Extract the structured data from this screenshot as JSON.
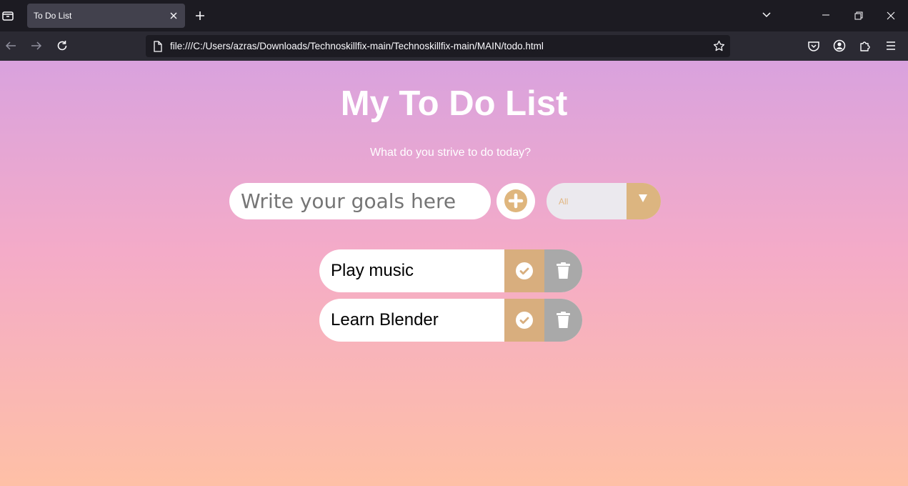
{
  "browser": {
    "tab_title": "To Do List",
    "url": "file:///C:/Users/azras/Downloads/Technoskillfix-main/Technoskillfix-main/MAIN/todo.html"
  },
  "page": {
    "title": "My To Do List",
    "subtitle": "What do you strive to do today?",
    "input_placeholder": "Write your goals here",
    "filter_selected": "All"
  },
  "todos": [
    {
      "text": "Play music"
    },
    {
      "text": "Learn Blender"
    }
  ],
  "colors": {
    "accent": "#dcb580",
    "trash": "#a9a9a9",
    "gradient_top": "#d9a2de",
    "gradient_bottom": "#fec0a6"
  },
  "icons": {
    "add": "plus-circle-icon",
    "complete": "check-circle-icon",
    "delete": "trash-icon"
  }
}
